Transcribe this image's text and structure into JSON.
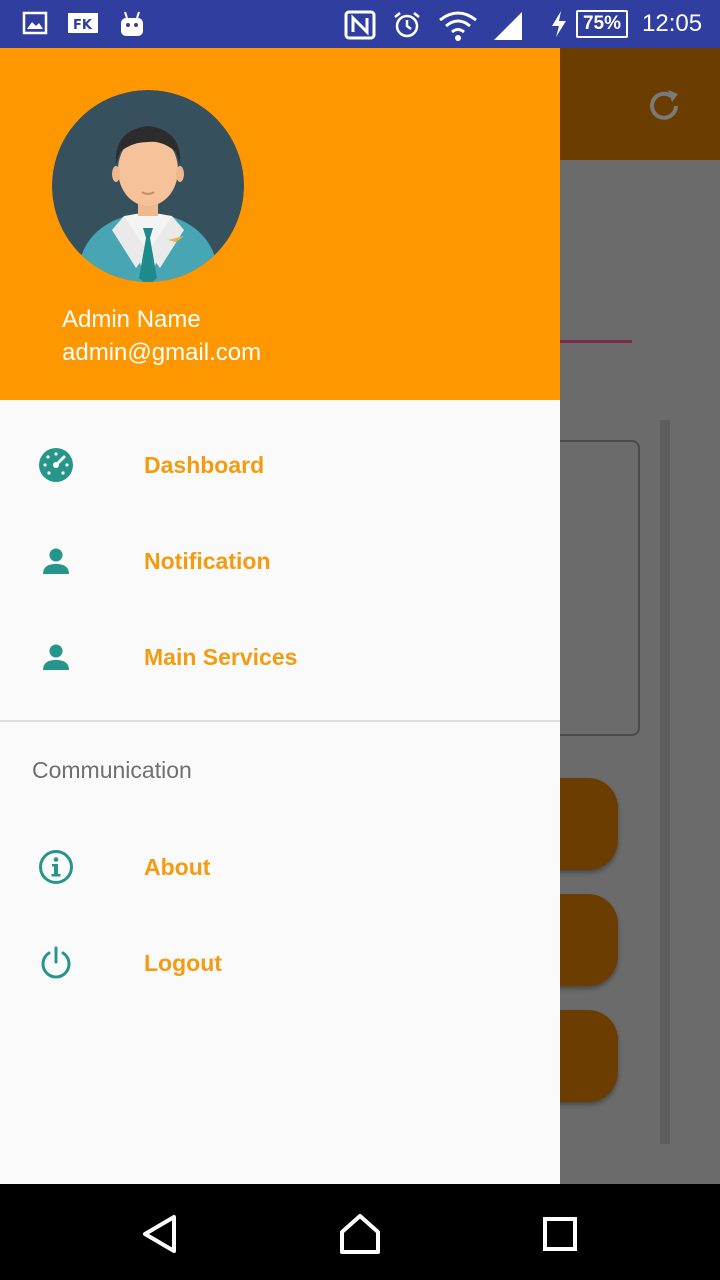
{
  "status_bar": {
    "time": "12:05",
    "battery": "75%",
    "icons": [
      "gallery-icon",
      "fk-app-icon",
      "android-icon",
      "nfc-icon",
      "alarm-icon",
      "wifi-icon",
      "signal-icon",
      "charging-icon",
      "battery-icon"
    ]
  },
  "profile": {
    "name": "Admin Name",
    "email": "admin@gmail.com"
  },
  "menu": [
    {
      "label": "Dashboard",
      "icon": "dashboard-icon"
    },
    {
      "label": "Notification",
      "icon": "person-icon"
    },
    {
      "label": "Main Services",
      "icon": "person-icon"
    }
  ],
  "communication": {
    "title": "Communication",
    "items": [
      {
        "label": "About",
        "icon": "info-icon"
      },
      {
        "label": "Logout",
        "icon": "power-icon"
      }
    ]
  },
  "colors": {
    "status_bar": "#303f9f",
    "header": "#ff9800",
    "menu_text": "#f39c12",
    "icon": "#26968a",
    "drawer_bg": "#fafafa"
  }
}
